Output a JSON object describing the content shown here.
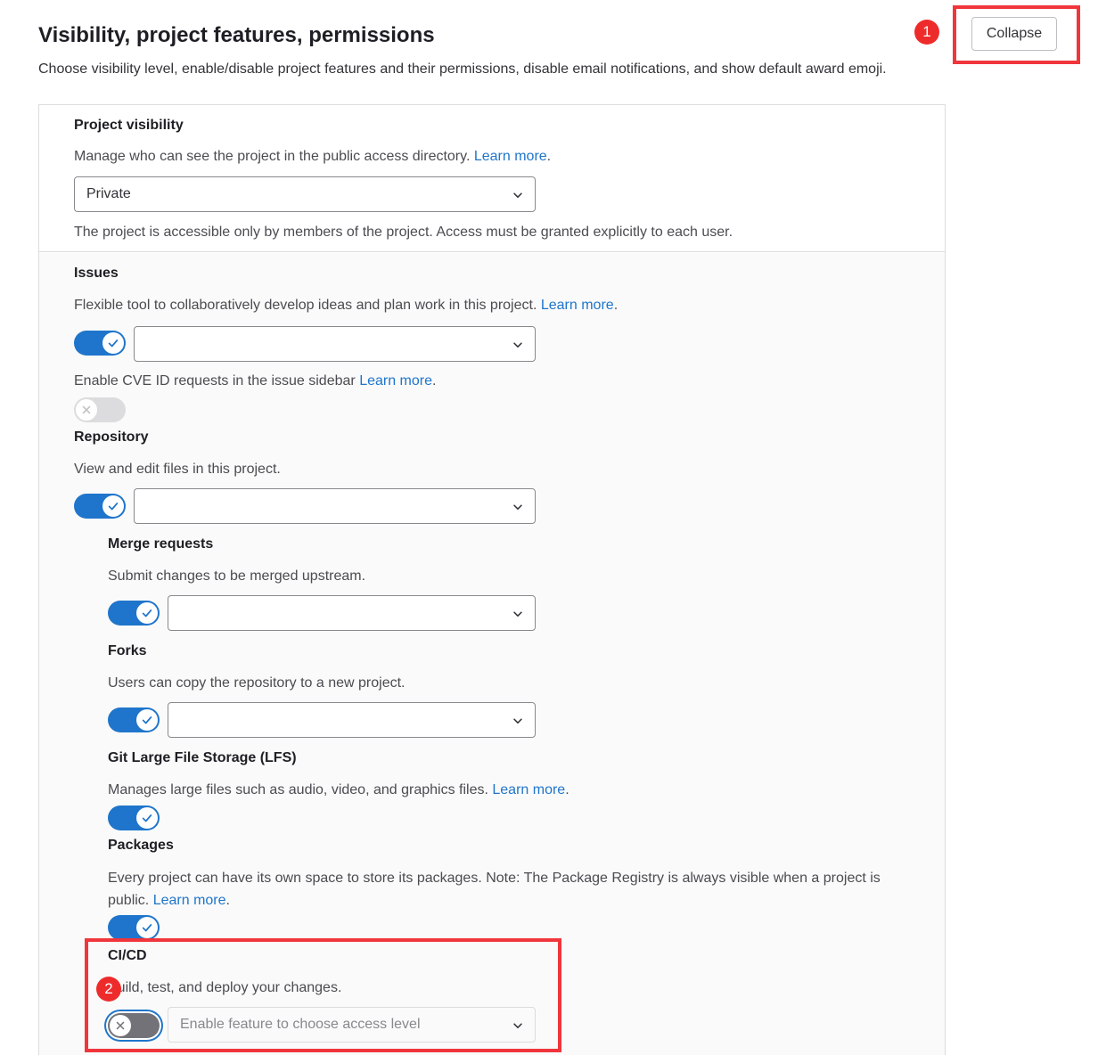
{
  "header": {
    "title": "Visibility, project features, permissions",
    "subtitle": "Choose visibility level, enable/disable project features and their permissions, disable email notifications, and show default award emoji.",
    "collapse_label": "Collapse"
  },
  "annotations": {
    "badge1": "1",
    "badge2": "2"
  },
  "visibility": {
    "label": "Project visibility",
    "description": "Manage who can see the project in the public access directory.",
    "learn_more": "Learn more",
    "period": ".",
    "selected": "Private",
    "help": "The project is accessible only by members of the project. Access must be granted explicitly to each user."
  },
  "features": {
    "issues": {
      "label": "Issues",
      "description": "Flexible tool to collaboratively develop ideas and plan work in this project.",
      "learn_more": "Learn more",
      "enabled": true,
      "access": ""
    },
    "cve": {
      "description": "Enable CVE ID requests in the issue sidebar",
      "learn_more": "Learn more",
      "enabled": false
    },
    "repository": {
      "label": "Repository",
      "description": "View and edit files in this project.",
      "enabled": true,
      "access": ""
    },
    "merge_requests": {
      "label": "Merge requests",
      "description": "Submit changes to be merged upstream.",
      "enabled": true,
      "access": ""
    },
    "forks": {
      "label": "Forks",
      "description": "Users can copy the repository to a new project.",
      "enabled": true,
      "access": ""
    },
    "lfs": {
      "label": "Git Large File Storage (LFS)",
      "description": "Manages large files such as audio, video, and graphics files.",
      "learn_more": "Learn more",
      "enabled": true
    },
    "packages": {
      "label": "Packages",
      "description_line1": "Every project can have its own space to store its packages. Note: The Package Registry is always visible when a project is",
      "description_line2": "public.",
      "learn_more": "Learn more",
      "enabled": true
    },
    "cicd": {
      "label": "CI/CD",
      "description": "Build, test, and deploy your changes.",
      "enabled": false,
      "access_placeholder": "Enable feature to choose access level"
    }
  },
  "colors": {
    "accent": "#1f75cb",
    "annotation_red": "#f0363c"
  }
}
